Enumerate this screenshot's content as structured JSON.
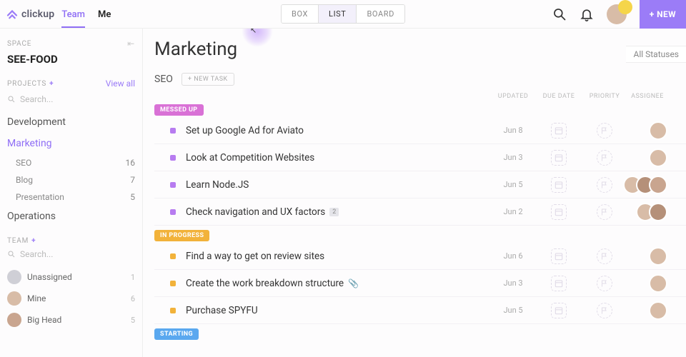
{
  "brand": {
    "name": "clickup"
  },
  "topTabs": {
    "team": "Team",
    "me": "Me"
  },
  "viewSwitch": {
    "box": "BOX",
    "list": "LIST",
    "board": "BOARD",
    "active": "list"
  },
  "newButton": "+ NEW",
  "filters": {
    "allStatuses": "All Statuses"
  },
  "sidebar": {
    "spaceLabel": "SPACE",
    "spaceName": "SEE-FOOD",
    "projectsLabel": "PROJECTS",
    "viewAll": "View all",
    "searchPlaceholder": "Search...",
    "projects": [
      {
        "name": "Development"
      },
      {
        "name": "Marketing",
        "active": true,
        "subs": [
          {
            "name": "SEO",
            "count": "16"
          },
          {
            "name": "Blog",
            "count": "7"
          },
          {
            "name": "Presentation",
            "count": "5"
          }
        ]
      },
      {
        "name": "Operations"
      }
    ],
    "teamLabel": "TEAM",
    "teamSearchPlaceholder": "Search...",
    "team": [
      {
        "name": "Unassigned",
        "count": "1"
      },
      {
        "name": "Mine",
        "count": "6"
      },
      {
        "name": "Big Head",
        "count": "5"
      }
    ]
  },
  "page": {
    "title": "Marketing",
    "listName": "SEO",
    "newTaskBtn": "+ NEW TASK",
    "cols": {
      "updated": "UPDATED",
      "due": "DUE DATE",
      "priority": "PRIORITY",
      "assignee": "ASSIGNEE"
    },
    "groups": [
      {
        "status": "MESSED UP",
        "cls": "pill-messed",
        "dot": "m",
        "tasks": [
          {
            "name": "Set up Google Ad for Aviato",
            "updated": "Jun 8",
            "assignees": 1
          },
          {
            "name": "Look at Competition Websites",
            "updated": "Jun 3",
            "assignees": 1
          },
          {
            "name": "Learn Node.JS",
            "updated": "Jun 5",
            "assignees": 3
          },
          {
            "name": "Check navigation and UX factors",
            "updated": "Jun 2",
            "badge": "2",
            "assignees": 2
          }
        ]
      },
      {
        "status": "IN PROGRESS",
        "cls": "pill-prog",
        "dot": "p",
        "tasks": [
          {
            "name": "Find a way to get on review sites",
            "updated": "Jun 6",
            "assignees": 1
          },
          {
            "name": "Create the work breakdown structure",
            "updated": "Jun 3",
            "clip": true,
            "assignees": 1
          },
          {
            "name": "Purchase SPYFU",
            "updated": "Jun 5",
            "assignees": 1
          }
        ]
      },
      {
        "status": "STARTING",
        "cls": "pill-start",
        "dot": "s",
        "tasks": []
      }
    ]
  }
}
